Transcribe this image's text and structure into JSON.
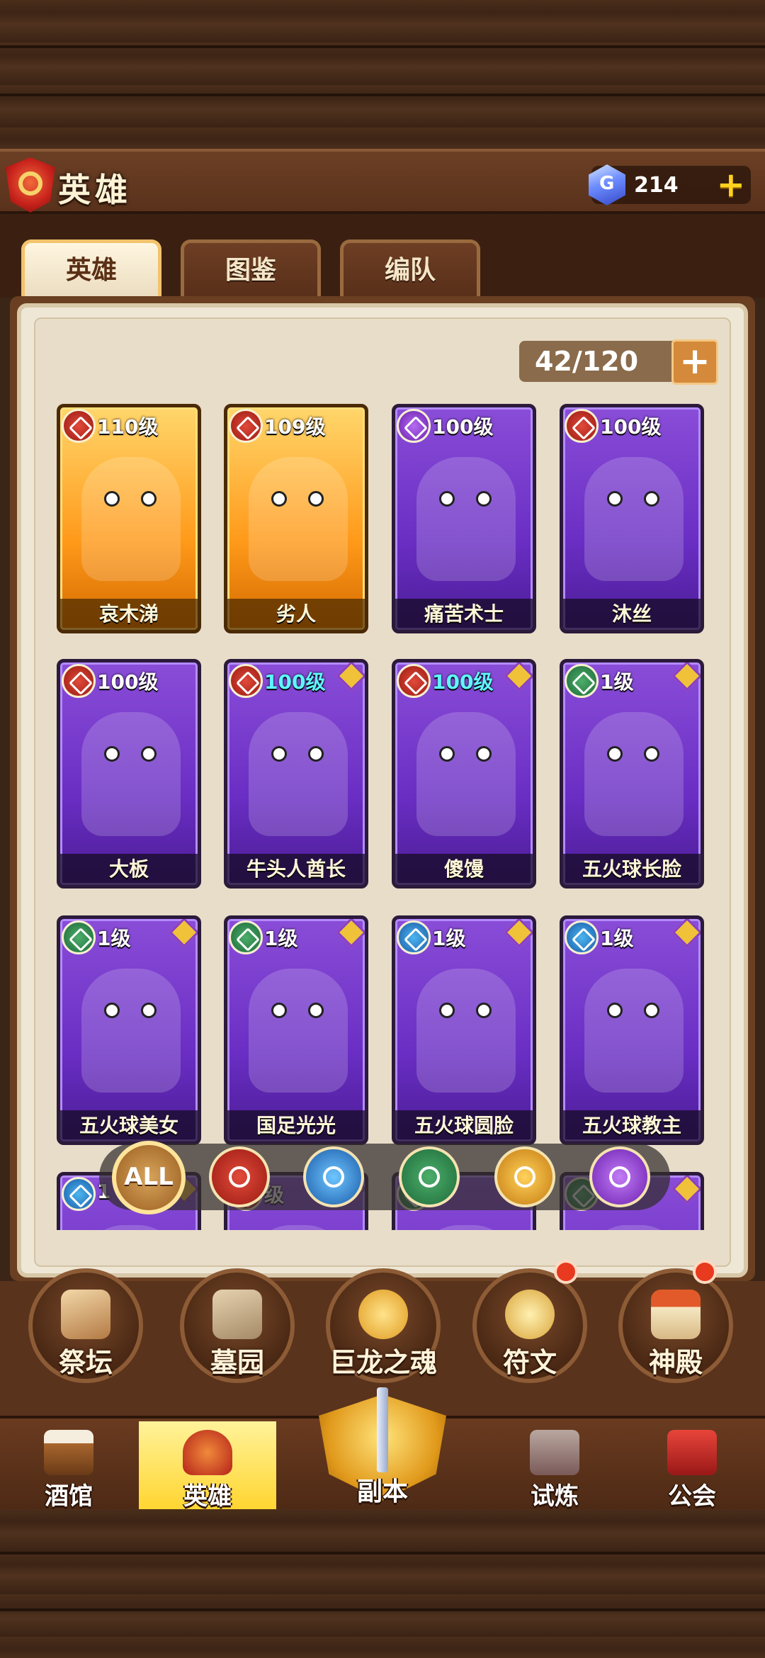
{
  "header": {
    "title": "英雄",
    "gems": "214",
    "add_gems": "+"
  },
  "tabs": [
    {
      "label": "英雄",
      "active": true
    },
    {
      "label": "图鉴",
      "active": false
    },
    {
      "label": "编队",
      "active": false
    }
  ],
  "roster": {
    "count": "42/120",
    "expand": "+"
  },
  "heroes": [
    {
      "name": "哀木涕",
      "level": "110级",
      "faction": "red",
      "rarity": "gold"
    },
    {
      "name": "劣人",
      "level": "109级",
      "faction": "red",
      "rarity": "gold"
    },
    {
      "name": "痛苦术士",
      "level": "100级",
      "faction": "purple",
      "rarity": "purple"
    },
    {
      "name": "沐丝",
      "level": "100级",
      "faction": "red",
      "rarity": "purple"
    },
    {
      "name": "大板",
      "level": "100级",
      "faction": "red",
      "rarity": "purple"
    },
    {
      "name": "牛头人酋长",
      "level": "100级",
      "faction": "red",
      "rarity": "purple",
      "level_color": "cyan"
    },
    {
      "name": "傻馒",
      "level": "100级",
      "faction": "red",
      "rarity": "purple",
      "level_color": "cyan"
    },
    {
      "name": "五火球长脸",
      "level": "1级",
      "faction": "green",
      "rarity": "purple"
    },
    {
      "name": "五火球美女",
      "level": "1级",
      "faction": "green",
      "rarity": "purple"
    },
    {
      "name": "国足光光",
      "level": "1级",
      "faction": "green",
      "rarity": "purple"
    },
    {
      "name": "五火球圆脸",
      "level": "1级",
      "faction": "blue",
      "rarity": "purple"
    },
    {
      "name": "五火球教主",
      "level": "1级",
      "faction": "blue",
      "rarity": "purple"
    },
    {
      "name": "",
      "level": "1",
      "faction": "blue",
      "rarity": "purple"
    },
    {
      "name": "",
      "level": "级",
      "faction": "red",
      "rarity": "purple"
    },
    {
      "name": "",
      "level": "",
      "faction": "green",
      "rarity": "purple"
    },
    {
      "name": "",
      "level": "",
      "faction": "green",
      "rarity": "purple"
    }
  ],
  "filters": {
    "all_label": "ALL",
    "icons": [
      "fire-faction-icon",
      "lion-faction-icon",
      "nature-faction-icon",
      "sun-faction-icon",
      "eye-faction-icon"
    ]
  },
  "functions": [
    {
      "label": "祭坛",
      "badge": false
    },
    {
      "label": "墓园",
      "badge": false
    },
    {
      "label": "巨龙之魂",
      "badge": false
    },
    {
      "label": "符文",
      "badge": true
    },
    {
      "label": "神殿",
      "badge": true
    }
  ],
  "nav": [
    {
      "label": "酒馆"
    },
    {
      "label": "英雄",
      "active": true
    },
    {
      "label": "副本",
      "center": true
    },
    {
      "label": "试炼"
    },
    {
      "label": "公会"
    }
  ],
  "colors": {
    "wood_dark": "#3b2516",
    "panel_bg": "#efe7d6",
    "gold_card": "#ff9a1a",
    "purple_card": "#6a2ec4",
    "nav_active": "#ffd530",
    "badge_red": "#e83a1e"
  }
}
